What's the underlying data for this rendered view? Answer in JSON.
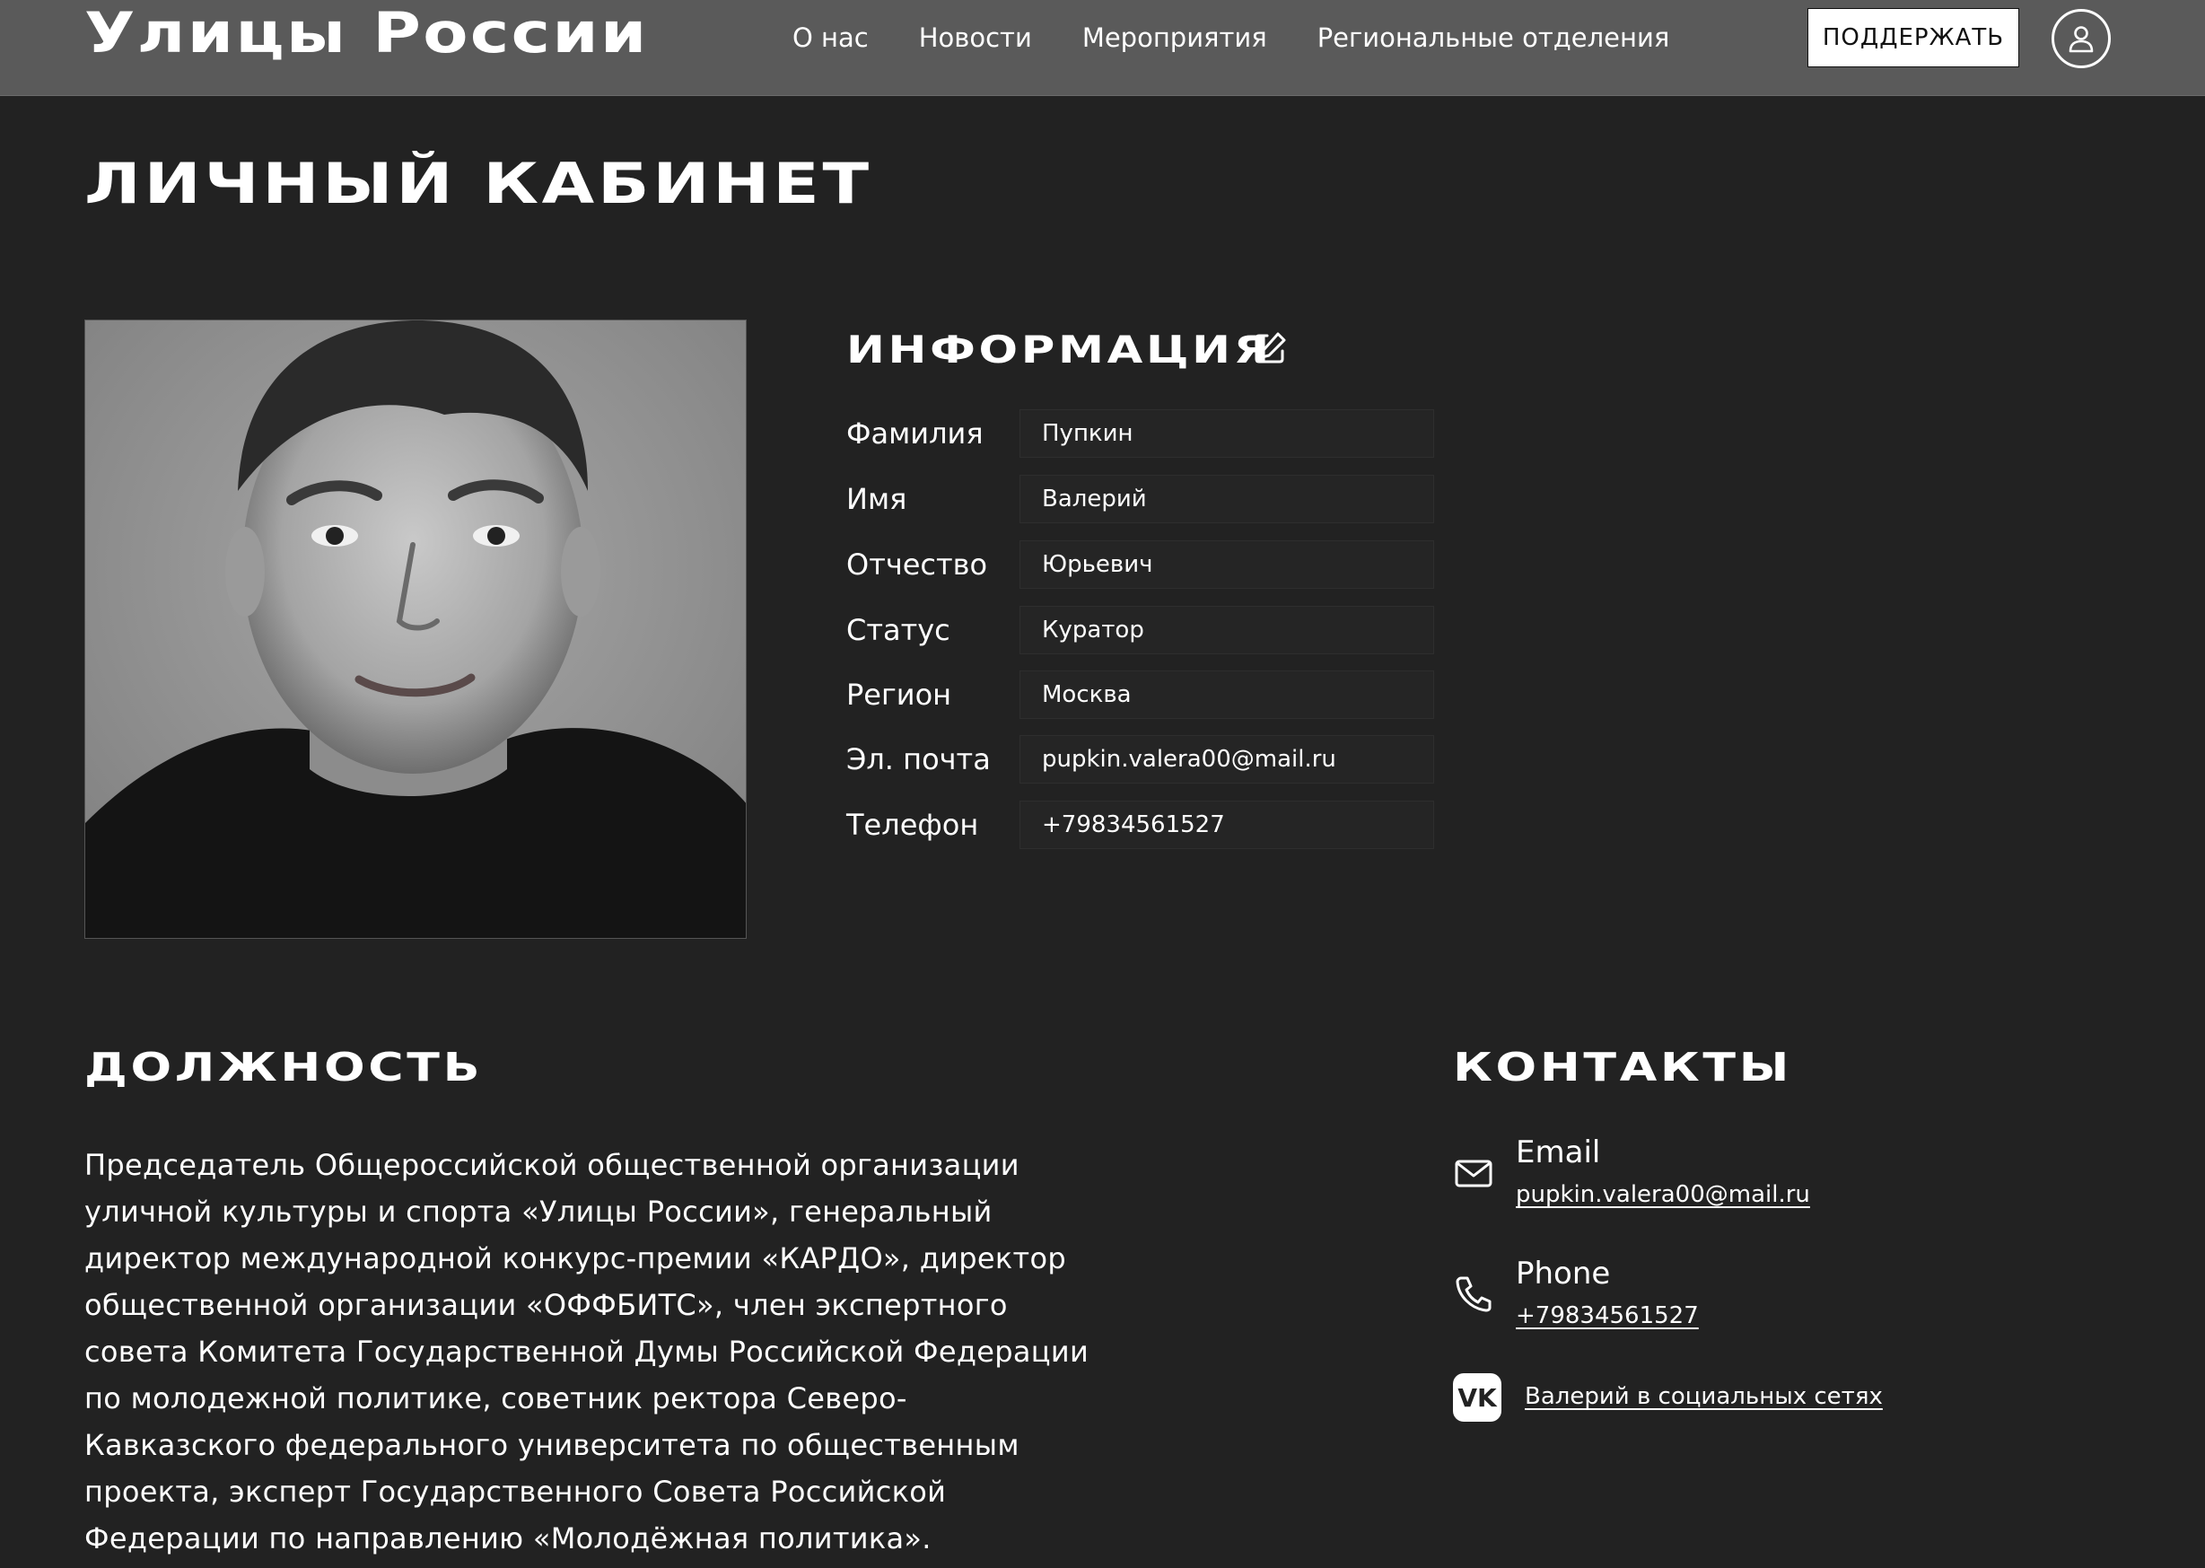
{
  "header": {
    "logo": "Улицы России",
    "nav": [
      "О нас",
      "Новости",
      "Мероприятия",
      "Региональные отделения"
    ],
    "support_label": "ПОДДЕРЖАТЬ",
    "profile_icon": "user-icon"
  },
  "page": {
    "title": "ЛИЧНЫЙ КАБИНЕТ"
  },
  "info": {
    "title": "ИНФОРМАЦИЯ",
    "edit_icon": "edit-icon",
    "fields": [
      {
        "label": "Фамилия",
        "value": "Пупкин"
      },
      {
        "label": "Имя",
        "value": "Валерий"
      },
      {
        "label": "Отчество",
        "value": "Юрьевич"
      },
      {
        "label": "Статус",
        "value": "Куратор"
      },
      {
        "label": "Регион",
        "value": "Москва"
      },
      {
        "label": "Эл. почта",
        "value": "pupkin.valera00@mail.ru"
      },
      {
        "label": "Телефон",
        "value": "+79834561527"
      }
    ]
  },
  "position": {
    "title": "ДОЛЖНОСТЬ",
    "text": "Председатель Общероссийской общественной организации уличной культуры и спорта «Улицы России», генеральный директор международной конкурс-премии «КАРДО», директор общественной организации «ОФФБИТС», член экспертного совета Комитета Государственной Думы Российской Федерации по молодежной политике, советник ректора Северо-Кавказского федерального университета по общественным проекта, эксперт Государственного Совета Российской Федерации по направлению «Молодёжная политика»."
  },
  "contacts": {
    "title": "КОНТАКТЫ",
    "email_label": "Email",
    "email": "pupkin.valera00@mail.ru",
    "phone_label": "Phone",
    "phone": "+79834561527",
    "social_link": "Валерий в социальных сетях"
  },
  "colors": {
    "background": "#222222",
    "header": "#5a5a5a",
    "field": "#252525",
    "text": "#ffffff"
  }
}
